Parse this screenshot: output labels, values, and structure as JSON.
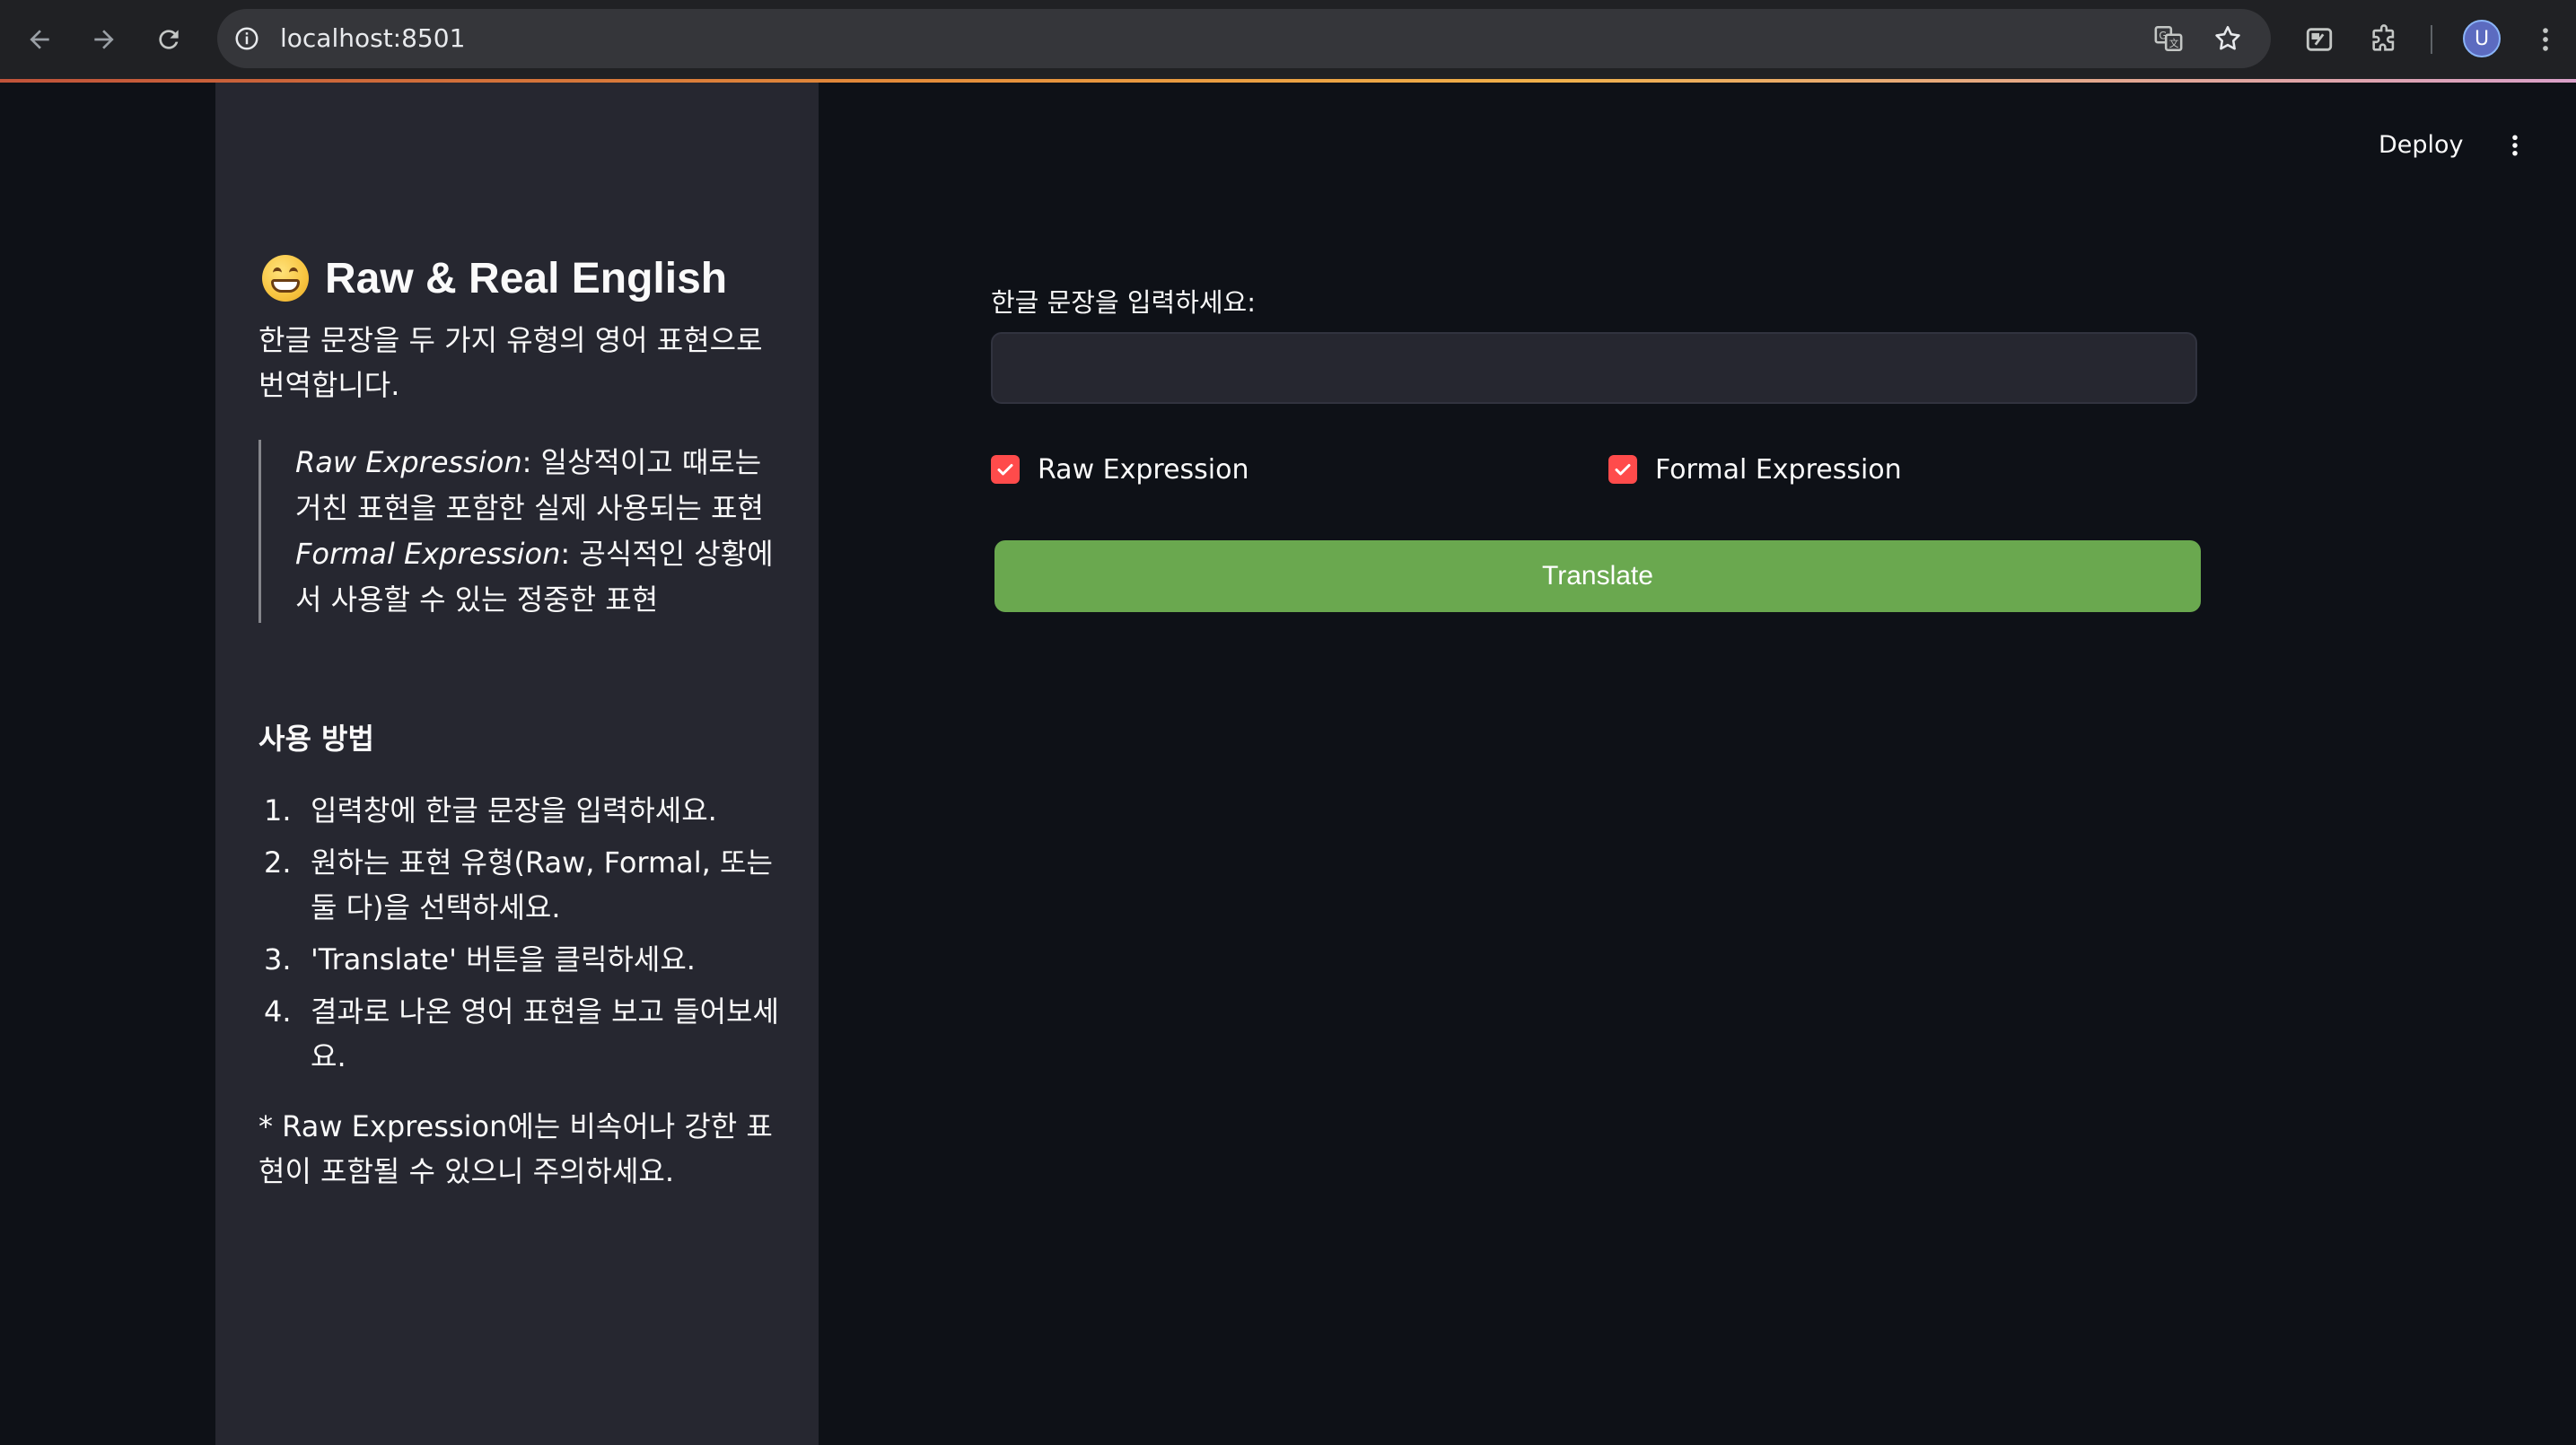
{
  "browser": {
    "url": "localhost:8501",
    "avatar_letter": "U"
  },
  "header": {
    "deploy_label": "Deploy"
  },
  "sidebar": {
    "title": "Raw & Real English",
    "title_icon": "grinning-face-icon",
    "description": "한글 문장을 두 가지 유형의 영어 표현으로 번역합니다.",
    "quote": {
      "raw_term": "Raw Expression",
      "raw_desc": ": 일상적이고 때로는 거친 표현을 포함한 실제 사용되는 표현",
      "formal_term": "Formal Expression",
      "formal_desc": ": 공식적인 상황에서 사용할 수 있는 정중한 표현"
    },
    "howto_title": "사용 방법",
    "steps": [
      {
        "num": "1.",
        "text": "입력창에 한글 문장을 입력하세요."
      },
      {
        "num": "2.",
        "text": "원하는 표현 유형(Raw, Formal, 또는 둘 다)을 선택하세요."
      },
      {
        "num": "3.",
        "text": "'Translate' 버튼을 클릭하세요."
      },
      {
        "num": "4.",
        "text": "결과로 나온 영어 표현을 보고 들어보세요."
      }
    ],
    "note": "* Raw Expression에는 비속어나 강한 표현이 포함될 수 있으니 주의하세요."
  },
  "main": {
    "input_label": "한글 문장을 입력하세요:",
    "input_value": "",
    "input_placeholder": "",
    "checkboxes": [
      {
        "label": "Raw Expression",
        "checked": true
      },
      {
        "label": "Formal Expression",
        "checked": true
      }
    ],
    "translate_label": "Translate"
  },
  "colors": {
    "background": "#0e1117",
    "sidebar": "#262730",
    "checkbox_accent": "#ff4b4b",
    "button": "#6aa84f"
  }
}
